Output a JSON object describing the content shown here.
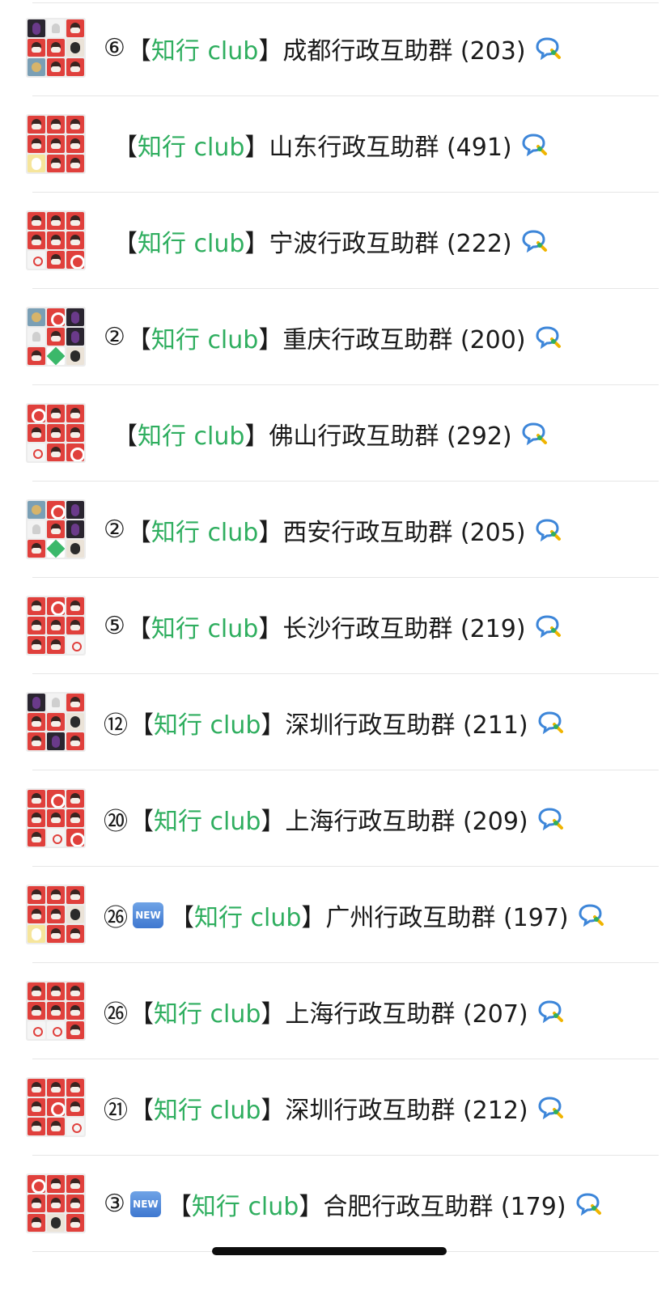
{
  "rows": [
    {
      "seq": "⑥",
      "new": false,
      "prefix": "【",
      "club": "知行 club",
      "suffix": "】",
      "name": "成都行政互助群 (203)",
      "avatar": [
        "dark",
        "ghost",
        "red",
        "red",
        "red",
        "face",
        "blue",
        "red",
        "red"
      ]
    },
    {
      "seq": "",
      "new": false,
      "prefix": "【",
      "club": "知行 club",
      "suffix": "】",
      "name": "山东行政互助群 (491)",
      "avatar": [
        "red",
        "red",
        "red",
        "red",
        "red",
        "red",
        "yellow",
        "red",
        "red"
      ]
    },
    {
      "seq": "",
      "new": false,
      "prefix": "【",
      "club": "知行 club",
      "suffix": "】",
      "name": "宁波行政互助群 (222)",
      "avatar": [
        "red",
        "red",
        "red",
        "red",
        "red",
        "red",
        "white",
        "red",
        "logo"
      ]
    },
    {
      "seq": "②",
      "new": false,
      "prefix": "【",
      "club": "知行 club",
      "suffix": "】",
      "name": "重庆行政互助群 (200)",
      "avatar": [
        "blue",
        "logo",
        "dark",
        "ghost",
        "red",
        "dark",
        "red",
        "green",
        "face"
      ]
    },
    {
      "seq": "",
      "new": false,
      "prefix": "【",
      "club": "知行 club",
      "suffix": "】",
      "name": "佛山行政互助群 (292)",
      "avatar": [
        "logo",
        "red",
        "red",
        "red",
        "red",
        "red",
        "white",
        "red",
        "logo"
      ]
    },
    {
      "seq": "②",
      "new": false,
      "prefix": "【",
      "club": "知行 club",
      "suffix": "】",
      "name": "西安行政互助群 (205)",
      "avatar": [
        "blue",
        "logo",
        "dark",
        "ghost",
        "red",
        "dark",
        "red",
        "green",
        "face"
      ]
    },
    {
      "seq": "⑤",
      "new": false,
      "prefix": "【",
      "club": "知行 club",
      "suffix": "】",
      "name": "长沙行政互助群 (219)",
      "avatar": [
        "red",
        "logo",
        "red",
        "red",
        "red",
        "red",
        "red",
        "red",
        "white"
      ]
    },
    {
      "seq": "⑫",
      "new": false,
      "prefix": "【",
      "club": "知行 club",
      "suffix": "】",
      "name": "深圳行政互助群 (211)",
      "avatar": [
        "dark",
        "ghost",
        "red",
        "red",
        "red",
        "face",
        "red",
        "dark",
        "red"
      ]
    },
    {
      "seq": "⑳",
      "new": false,
      "prefix": "【",
      "club": "知行 club",
      "suffix": "】",
      "name": "上海行政互助群 (209)",
      "avatar": [
        "red",
        "logo",
        "red",
        "red",
        "red",
        "red",
        "red",
        "white",
        "logo"
      ]
    },
    {
      "seq": "㉖",
      "new": true,
      "new_label": "NEW",
      "prefix": "【",
      "club": "知行 club",
      "suffix": "】",
      "name": "广州行政互助群 (197)",
      "avatar": [
        "red",
        "red",
        "red",
        "red",
        "red",
        "face",
        "yellow",
        "red",
        "red"
      ]
    },
    {
      "seq": "㉖",
      "new": false,
      "prefix": "【",
      "club": "知行 club",
      "suffix": "】",
      "name": "上海行政互助群 (207)",
      "avatar": [
        "red",
        "red",
        "red",
        "red",
        "red",
        "red",
        "white",
        "white",
        "red"
      ]
    },
    {
      "seq": "㉑",
      "new": false,
      "prefix": "【",
      "club": "知行 club",
      "suffix": "】",
      "name": "深圳行政互助群 (212)",
      "avatar": [
        "red",
        "red",
        "red",
        "red",
        "logo",
        "red",
        "red",
        "red",
        "white"
      ]
    },
    {
      "seq": "③",
      "new": true,
      "new_label": "NEW",
      "prefix": "【",
      "club": "知行 club",
      "suffix": "】",
      "name": "合肥行政互助群 (179)",
      "avatar": [
        "logo",
        "red",
        "red",
        "red",
        "red",
        "red",
        "red",
        "face",
        "red"
      ]
    }
  ],
  "colors": {
    "accent_green": "#2fae5f",
    "new_badge": "#4a84d6",
    "avatar_red": "#e0403c"
  },
  "icons": {
    "chat": "wecom-chat-icon"
  }
}
